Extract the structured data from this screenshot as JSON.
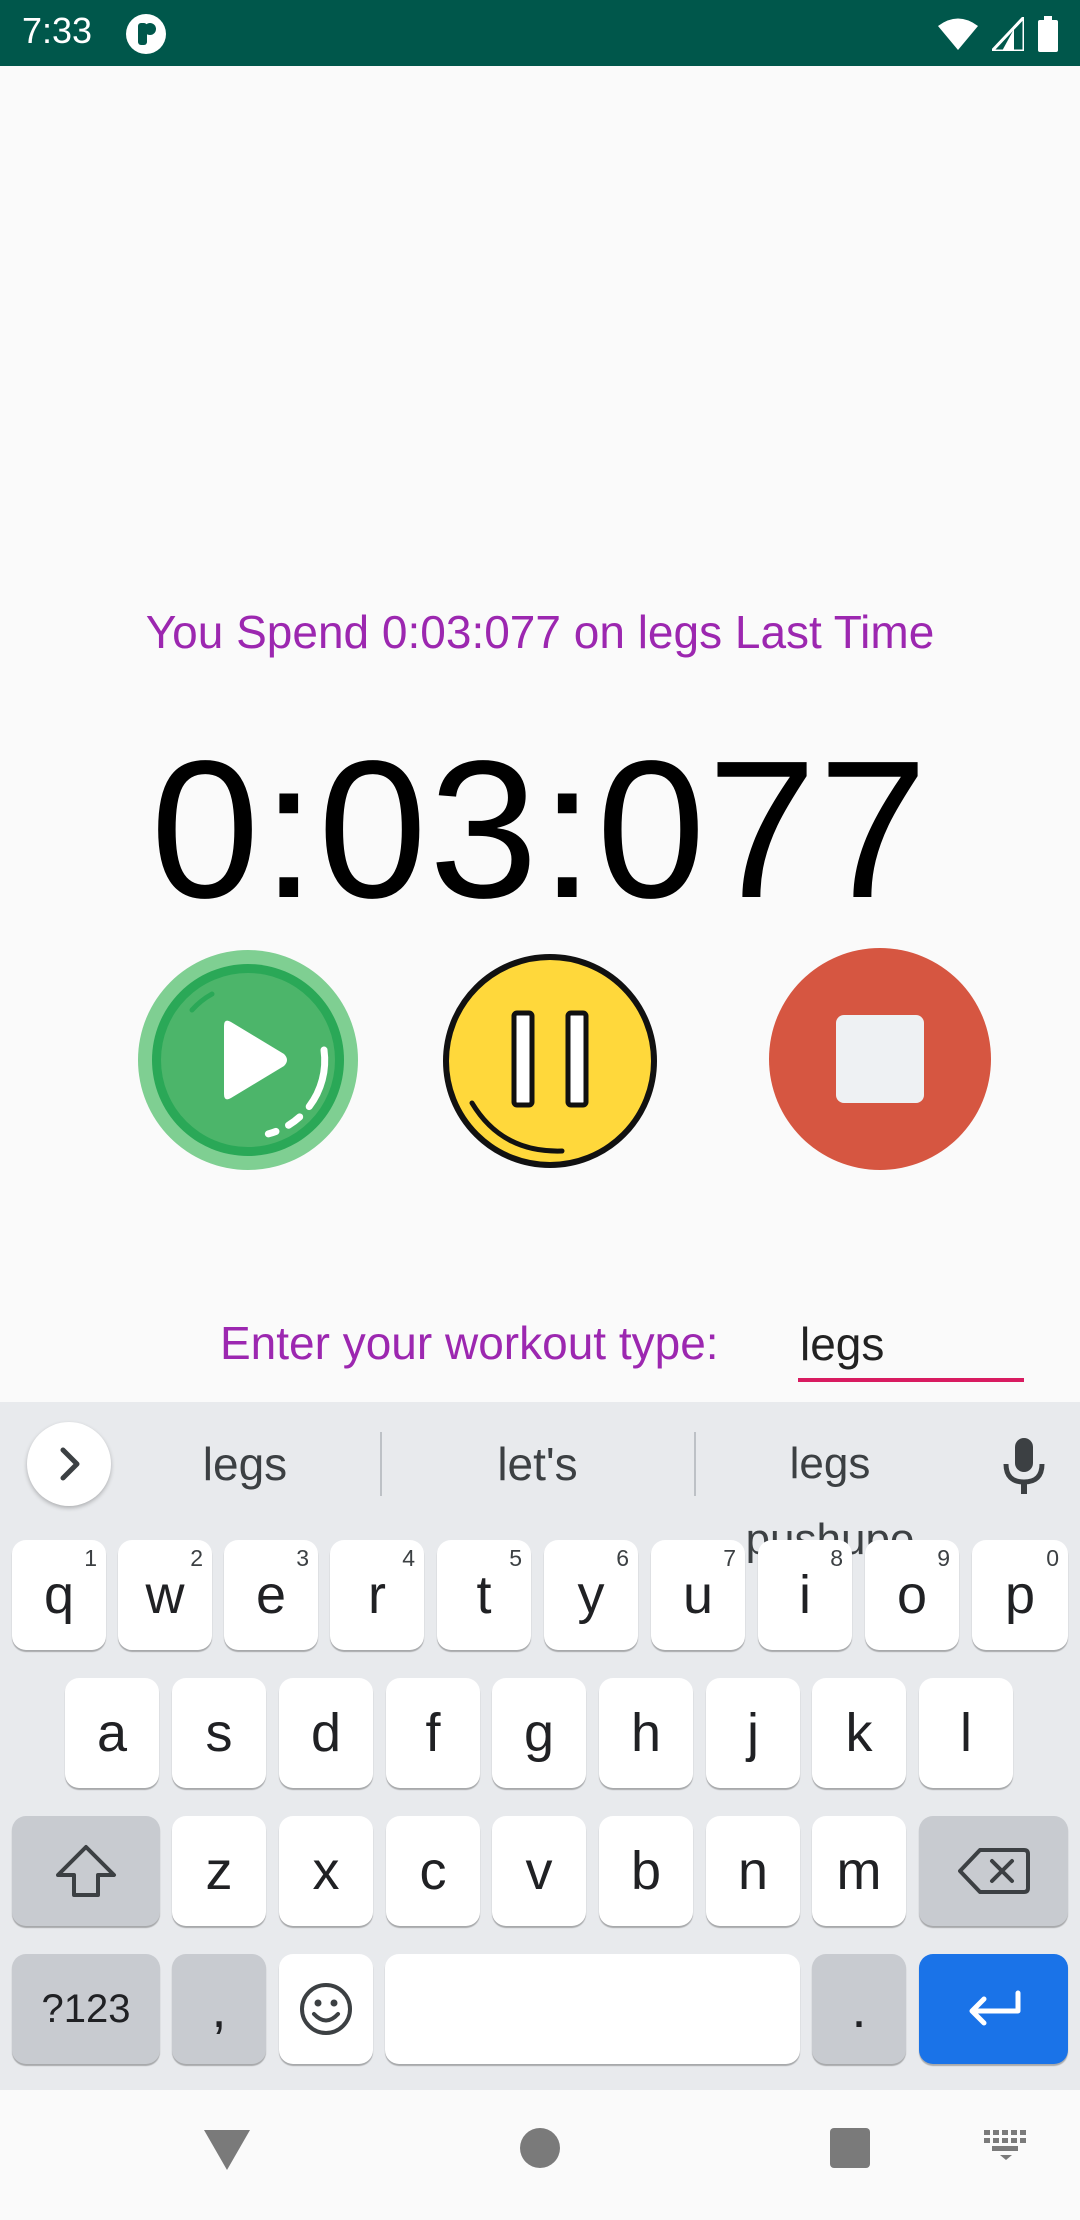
{
  "status_bar": {
    "time": "7:33",
    "app_icon": "app-notification-icon",
    "icons": [
      "wifi-icon",
      "cell-signal-icon",
      "battery-icon"
    ],
    "background": "#00574b"
  },
  "main": {
    "last_time_message": "You Spend 0:03:077 on legs Last Time",
    "timer": "0:03:077",
    "accent_color": "#9c27b0",
    "controls": [
      {
        "name": "play-button",
        "icon": "play-icon",
        "color": "#4cb56a"
      },
      {
        "name": "pause-button",
        "icon": "pause-icon",
        "color": "#ffd83b"
      },
      {
        "name": "stop-button",
        "icon": "stop-icon",
        "color": "#d65641"
      }
    ],
    "workout_label": "Enter your workout type:",
    "workout_value": "legs"
  },
  "keyboard": {
    "suggestions": [
      "legs",
      "let's",
      "legs pushupo"
    ],
    "row1": [
      {
        "key": "q",
        "hint": "1"
      },
      {
        "key": "w",
        "hint": "2"
      },
      {
        "key": "e",
        "hint": "3"
      },
      {
        "key": "r",
        "hint": "4"
      },
      {
        "key": "t",
        "hint": "5"
      },
      {
        "key": "y",
        "hint": "6"
      },
      {
        "key": "u",
        "hint": "7"
      },
      {
        "key": "i",
        "hint": "8"
      },
      {
        "key": "o",
        "hint": "9"
      },
      {
        "key": "p",
        "hint": "0"
      }
    ],
    "row2": [
      "a",
      "s",
      "d",
      "f",
      "g",
      "h",
      "j",
      "k",
      "l"
    ],
    "row3": [
      "z",
      "x",
      "c",
      "v",
      "b",
      "n",
      "m"
    ],
    "row4": {
      "symbols": "?123",
      "comma": ",",
      "period": "."
    },
    "enter_color": "#1a73e8"
  },
  "nav_bar": {
    "icons": [
      "back-icon",
      "home-icon",
      "recents-icon",
      "keyboard-switch-icon"
    ]
  }
}
